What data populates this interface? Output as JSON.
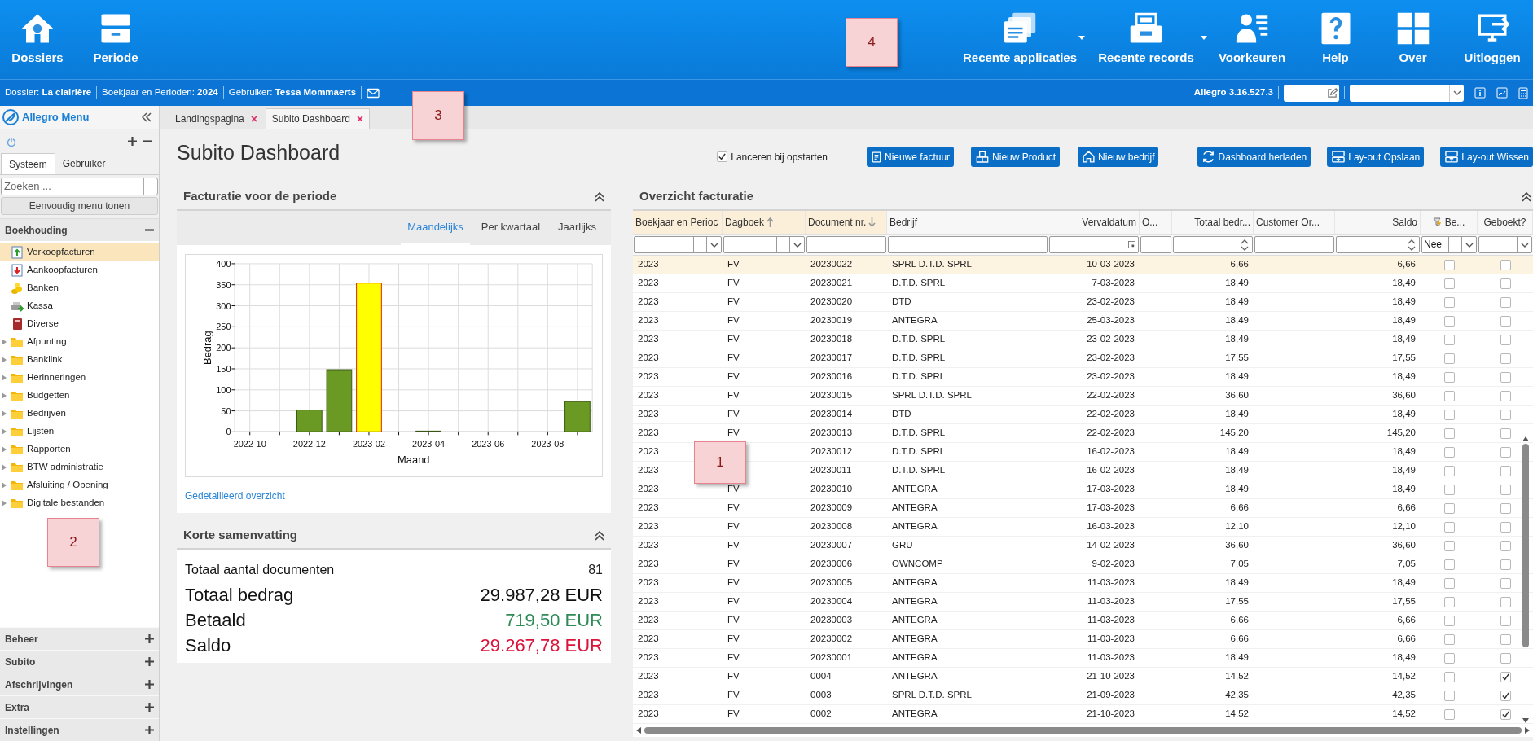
{
  "toolbar": {
    "left_buttons": [
      {
        "label": "Dossiers"
      },
      {
        "label": "Periode"
      }
    ],
    "right_buttons": [
      {
        "label": "Recente applicaties",
        "dropdown": true
      },
      {
        "label": "Recente records",
        "dropdown": true
      },
      {
        "label": "Voorkeuren",
        "dropdown": false
      },
      {
        "label": "Help",
        "dropdown": false
      },
      {
        "label": "Over",
        "dropdown": false
      },
      {
        "label": "Uitloggen",
        "dropdown": false
      }
    ]
  },
  "info_bar": {
    "items": [
      "Dossier: **La clairière**",
      "Boekjaar en Perioden: **2024**",
      "Gebruiker: **Tessa Mommaerts**"
    ],
    "version": "Allegro 3.16.527.3"
  },
  "sidebar": {
    "title": "Allegro Menu",
    "tabs": [
      {
        "label": "Systeem",
        "selected": true
      },
      {
        "label": "Gebruiker",
        "selected": false
      }
    ],
    "search": {
      "placeholder": "Zoeken ..."
    },
    "simple_menu_button": "Eenvoudig menu tonen",
    "sections": [
      {
        "label": "Boekhouding",
        "expanded": true,
        "items": [
          {
            "label": "Verkoopfacturen",
            "kind": "sales",
            "selected": true
          },
          {
            "label": "Aankoopfacturen",
            "kind": "purchase",
            "selected": false
          },
          {
            "label": "Banken",
            "kind": "bank",
            "selected": false
          },
          {
            "label": "Kassa",
            "kind": "cash",
            "selected": false
          },
          {
            "label": "Diverse",
            "kind": "misc",
            "selected": false
          },
          {
            "label": "Afpunting",
            "kind": "folder",
            "selected": false
          },
          {
            "label": "Banklink",
            "kind": "folder",
            "selected": false
          },
          {
            "label": "Herinneringen",
            "kind": "folder",
            "selected": false
          },
          {
            "label": "Budgetten",
            "kind": "folder",
            "selected": false
          },
          {
            "label": "Bedrijven",
            "kind": "folder",
            "selected": false
          },
          {
            "label": "Lijsten",
            "kind": "folder",
            "selected": false
          },
          {
            "label": "Rapporten",
            "kind": "folder",
            "selected": false
          },
          {
            "label": "BTW administratie",
            "kind": "folder",
            "selected": false
          },
          {
            "label": "Afsluiting / Opening",
            "kind": "folder",
            "selected": false
          },
          {
            "label": "Digitale bestanden",
            "kind": "folder",
            "selected": false
          }
        ]
      },
      {
        "label": "Beheer",
        "expanded": false
      },
      {
        "label": "Subito",
        "expanded": false
      },
      {
        "label": "Afschrijvingen",
        "expanded": false
      },
      {
        "label": "Extra",
        "expanded": false
      },
      {
        "label": "Instellingen",
        "expanded": false
      }
    ]
  },
  "tabs": [
    {
      "label": "Landingspagina",
      "selected": false
    },
    {
      "label": "Subito Dashboard",
      "selected": true
    }
  ],
  "page": {
    "title": "Subito Dashboard",
    "launch_on_startup": {
      "label": "Lanceren bij opstarten",
      "checked": true
    },
    "actions": [
      {
        "label": "Nieuwe factuur"
      },
      {
        "label": "Nieuw Product"
      },
      {
        "label": "Nieuw bedrijf"
      },
      {
        "label": "Dashboard herladen"
      },
      {
        "label": "Lay-out Opslaan"
      },
      {
        "label": "Lay-out Wissen"
      }
    ]
  },
  "invoicing_panel": {
    "title": "Facturatie voor de periode",
    "period_tabs": [
      {
        "label": "Maandelijks",
        "selected": true
      },
      {
        "label": "Per kwartaal",
        "selected": false
      },
      {
        "label": "Jaarlijks",
        "selected": false
      }
    ],
    "chart_data": {
      "type": "bar",
      "xlabel": "Maand",
      "ylabel": "Bedrag",
      "grid": true,
      "categories": [
        "2022-10",
        null,
        "2022-12",
        null,
        "2023-02",
        null,
        "2023-04",
        null,
        "2023-06",
        null,
        "2023-08",
        null
      ],
      "series": [
        {
          "color": "#6b9a24",
          "values": [
            0,
            0,
            52,
            148,
            null,
            0,
            2,
            0,
            0,
            0,
            0,
            72
          ]
        },
        {
          "color": "#ffff00",
          "values": [
            null,
            null,
            null,
            null,
            354,
            null,
            null,
            null,
            null,
            null,
            null,
            null
          ]
        }
      ],
      "ylim": [
        0,
        400
      ],
      "yticks": [
        0,
        50,
        100,
        150,
        200,
        250,
        300,
        350,
        400
      ]
    },
    "link": "Gedetailleerd overzicht"
  },
  "summary_panel": {
    "title": "Korte samenvatting",
    "rows": [
      {
        "label": "Totaal aantal documenten",
        "value": "81",
        "kind": "count"
      },
      {
        "label": "Totaal bedrag",
        "value": "29.987,28 EUR",
        "kind": "total"
      },
      {
        "label": "Betaald",
        "value": "719,50 EUR",
        "kind": "paid"
      },
      {
        "label": "Saldo",
        "value": "29.267,78 EUR",
        "kind": "balance"
      }
    ]
  },
  "overview": {
    "title": "Overzicht facturatie",
    "columns": [
      {
        "label": "Boekjaar en Perioc",
        "kind": "text",
        "sorted": true,
        "filter": {
          "kind": "select"
        }
      },
      {
        "label": "Dagboek",
        "kind": "text",
        "sorted": true,
        "ascending": true,
        "filter": {
          "kind": "select"
        }
      },
      {
        "label": "Document nr.",
        "kind": "text",
        "sorted": true,
        "ascending": false,
        "filter": {
          "kind": "text"
        }
      },
      {
        "label": "Bedrijf",
        "kind": "text",
        "sorted": false,
        "filter": {
          "kind": "text"
        }
      },
      {
        "label": "Vervaldatum",
        "kind": "number",
        "sorted": false,
        "filter": {
          "kind": "date"
        }
      },
      {
        "label": "O...",
        "kind": "text",
        "sorted": false,
        "filter": {
          "kind": "text"
        }
      },
      {
        "label": "Totaal bedr...",
        "kind": "number",
        "sorted": false,
        "filter": {
          "kind": "spin"
        }
      },
      {
        "label": "Customer Or...",
        "kind": "text",
        "sorted": false,
        "filter": {
          "kind": "text"
        }
      },
      {
        "label": "Saldo",
        "kind": "number",
        "sorted": false,
        "filter": {
          "kind": "spin"
        }
      },
      {
        "label": "Be...",
        "kind": "check",
        "sorted": false,
        "filtered": true,
        "filter": {
          "kind": "select",
          "value": "Nee"
        }
      },
      {
        "label": "Geboekt?",
        "kind": "check",
        "sorted": false,
        "filtered": false,
        "filter": {
          "kind": "select"
        }
      }
    ],
    "rows": [
      {
        "year": "2023",
        "journal": "FV",
        "doc": "20230022",
        "company": "SPRL D.T.D. SPRL",
        "due": "10-03-2023",
        "total": "6,66",
        "balance": "6,66",
        "be": false,
        "booked": false,
        "selected": true
      },
      {
        "year": "2023",
        "journal": "FV",
        "doc": "20230021",
        "company": "D.T.D. SPRL",
        "due": "7-03-2023",
        "total": "18,49",
        "balance": "18,49",
        "be": false,
        "booked": false,
        "selected": false
      },
      {
        "year": "2023",
        "journal": "FV",
        "doc": "20230020",
        "company": "DTD",
        "due": "23-02-2023",
        "total": "18,49",
        "balance": "18,49",
        "be": false,
        "booked": false,
        "selected": false
      },
      {
        "year": "2023",
        "journal": "FV",
        "doc": "20230019",
        "company": "ANTEGRA",
        "due": "25-03-2023",
        "total": "18,49",
        "balance": "18,49",
        "be": false,
        "booked": false,
        "selected": false
      },
      {
        "year": "2023",
        "journal": "FV",
        "doc": "20230018",
        "company": "D.T.D. SPRL",
        "due": "23-02-2023",
        "total": "18,49",
        "balance": "18,49",
        "be": false,
        "booked": false,
        "selected": false
      },
      {
        "year": "2023",
        "journal": "FV",
        "doc": "20230017",
        "company": "D.T.D. SPRL",
        "due": "23-02-2023",
        "total": "17,55",
        "balance": "17,55",
        "be": false,
        "booked": false,
        "selected": false
      },
      {
        "year": "2023",
        "journal": "FV",
        "doc": "20230016",
        "company": "D.T.D. SPRL",
        "due": "23-02-2023",
        "total": "18,49",
        "balance": "18,49",
        "be": false,
        "booked": false,
        "selected": false
      },
      {
        "year": "2023",
        "journal": "FV",
        "doc": "20230015",
        "company": "SPRL D.T.D. SPRL",
        "due": "22-02-2023",
        "total": "36,60",
        "balance": "36,60",
        "be": false,
        "booked": false,
        "selected": false
      },
      {
        "year": "2023",
        "journal": "FV",
        "doc": "20230014",
        "company": "DTD",
        "due": "22-02-2023",
        "total": "18,49",
        "balance": "18,49",
        "be": false,
        "booked": false,
        "selected": false
      },
      {
        "year": "2023",
        "journal": "FV",
        "doc": "20230013",
        "company": "D.T.D. SPRL",
        "due": "22-02-2023",
        "total": "145,20",
        "balance": "145,20",
        "be": false,
        "booked": false,
        "selected": false
      },
      {
        "year": "2023",
        "doc": "20230012",
        "company": "D.T.D. SPRL",
        "due": "16-02-2023",
        "total": "18,49",
        "balance": "18,49",
        "be": false,
        "booked": false,
        "selected": false
      },
      {
        "year": "2023",
        "doc": "20230011",
        "company": "D.T.D. SPRL",
        "due": "16-02-2023",
        "total": "18,49",
        "balance": "18,49",
        "be": false,
        "booked": false,
        "selected": false
      },
      {
        "year": "2023",
        "journal": "FV",
        "doc": "20230010",
        "company": "ANTEGRA",
        "due": "17-03-2023",
        "total": "18,49",
        "balance": "18,49",
        "be": false,
        "booked": false,
        "selected": false
      },
      {
        "year": "2023",
        "journal": "FV",
        "doc": "20230009",
        "company": "ANTEGRA",
        "due": "17-03-2023",
        "total": "6,66",
        "balance": "6,66",
        "be": false,
        "booked": false,
        "selected": false
      },
      {
        "year": "2023",
        "journal": "FV",
        "doc": "20230008",
        "company": "ANTEGRA",
        "due": "16-03-2023",
        "total": "12,10",
        "balance": "12,10",
        "be": false,
        "booked": false,
        "selected": false
      },
      {
        "year": "2023",
        "journal": "FV",
        "doc": "20230007",
        "company": "GRU",
        "due": "14-02-2023",
        "total": "36,60",
        "balance": "36,60",
        "be": false,
        "booked": false,
        "selected": false
      },
      {
        "year": "2023",
        "journal": "FV",
        "doc": "20230006",
        "company": "OWNCOMP",
        "due": "9-02-2023",
        "total": "7,05",
        "balance": "7,05",
        "be": false,
        "booked": false,
        "selected": false
      },
      {
        "year": "2023",
        "journal": "FV",
        "doc": "20230005",
        "company": "ANTEGRA",
        "due": "11-03-2023",
        "total": "18,49",
        "balance": "18,49",
        "be": false,
        "booked": false,
        "selected": false
      },
      {
        "year": "2023",
        "journal": "FV",
        "doc": "20230004",
        "company": "ANTEGRA",
        "due": "11-03-2023",
        "total": "17,55",
        "balance": "17,55",
        "be": false,
        "booked": false,
        "selected": false
      },
      {
        "year": "2023",
        "journal": "FV",
        "doc": "20230003",
        "company": "ANTEGRA",
        "due": "11-03-2023",
        "total": "6,66",
        "balance": "6,66",
        "be": false,
        "booked": false,
        "selected": false
      },
      {
        "year": "2023",
        "journal": "FV",
        "doc": "20230002",
        "company": "ANTEGRA",
        "due": "11-03-2023",
        "total": "6,66",
        "balance": "6,66",
        "be": false,
        "booked": false,
        "selected": false
      },
      {
        "year": "2023",
        "journal": "FV",
        "doc": "20230001",
        "company": "ANTEGRA",
        "due": "11-03-2023",
        "total": "18,49",
        "balance": "18,49",
        "be": false,
        "booked": false,
        "selected": false
      },
      {
        "year": "2023",
        "journal": "FV",
        "doc": "0004",
        "company": "ANTEGRA",
        "due": "21-10-2023",
        "total": "14,52",
        "balance": "14,52",
        "be": false,
        "booked": true,
        "selected": false
      },
      {
        "year": "2023",
        "journal": "FV",
        "doc": "0003",
        "company": "SPRL D.T.D. SPRL",
        "due": "21-09-2023",
        "total": "42,35",
        "balance": "42,35",
        "be": false,
        "booked": true,
        "selected": false
      },
      {
        "year": "2023",
        "journal": "FV",
        "doc": "0002",
        "company": "ANTEGRA",
        "due": "21-10-2023",
        "total": "14,52",
        "balance": "14,52",
        "be": false,
        "booked": true,
        "selected": false
      }
    ]
  },
  "notes": [
    {
      "label": "4"
    },
    {
      "label": "3"
    },
    {
      "label": "2"
    },
    {
      "label": "1"
    }
  ]
}
